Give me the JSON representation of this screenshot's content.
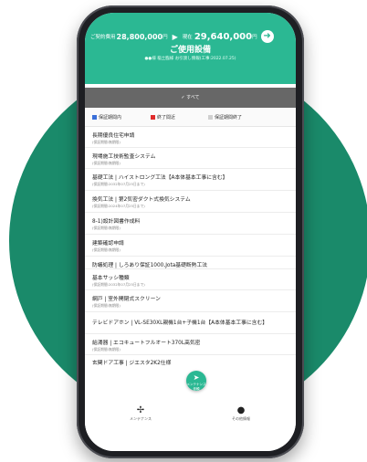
{
  "side_text": "",
  "header": {
    "total_label": "ご契約費用",
    "total_value": "28,800,000",
    "total_unit": "円",
    "current_label": "現在",
    "current_value": "29,640,000",
    "current_unit": "円",
    "title": "ご使用設備",
    "subtitle": "●●様 稲土臨様 お引渡し情報(工事:2022.07.25)"
  },
  "filter": {
    "label": "✓ すべて"
  },
  "legend": [
    {
      "label": "保証期間内",
      "color": "#3b6fd9"
    },
    {
      "label": "終了間近",
      "color": "#e02b2b"
    },
    {
      "label": "保証期間終了",
      "color": "#d0d0d0"
    }
  ],
  "items": [
    {
      "name": "長期優良住宅申請",
      "status": "(保証期間:無期限)"
    },
    {
      "name": "現場施工技術監査システム",
      "status": "(保証期間:無期限)"
    },
    {
      "name": "基礎工法 | ハイストロング工法【A本体基本工事に含む】",
      "status": "(保証期間:2032年07月25日まで)"
    },
    {
      "name": "換気工法 | 第2気密ダクト式換気システム",
      "status": "(保証期間:2024年07月25日まで)"
    },
    {
      "name": "8-1)設計図書作成料",
      "status": "(保証期間:無期限)"
    },
    {
      "name": "建築確認申請",
      "status": "(保証期間:無期限)"
    },
    {
      "name": "防蟻処理 | しろあり保証1000,Jota基礎断熱工法",
      "status": ""
    },
    {
      "name": "基本サッシ種類",
      "status": "(保証期間:2032年07月25日まで)"
    },
    {
      "name": "網戸 | 室外開閉式スクリーン",
      "status": "(保証期間:無期限)"
    },
    {
      "name": "テレビドアホン | VL-SE30XL親機1台+子機1台【A本体基本工事に含む】",
      "status": ""
    },
    {
      "name": "給湯器 | エコキュートフルオート370L高気密",
      "status": "(保証期間:無期限)"
    },
    {
      "name": "玄関ドア工事 | ジエスタ2K2仕様",
      "status": ""
    }
  ],
  "nav": {
    "maintenance": "メンテナンス",
    "other": "その他情報",
    "fab_label": "メンテナンス依頼"
  }
}
